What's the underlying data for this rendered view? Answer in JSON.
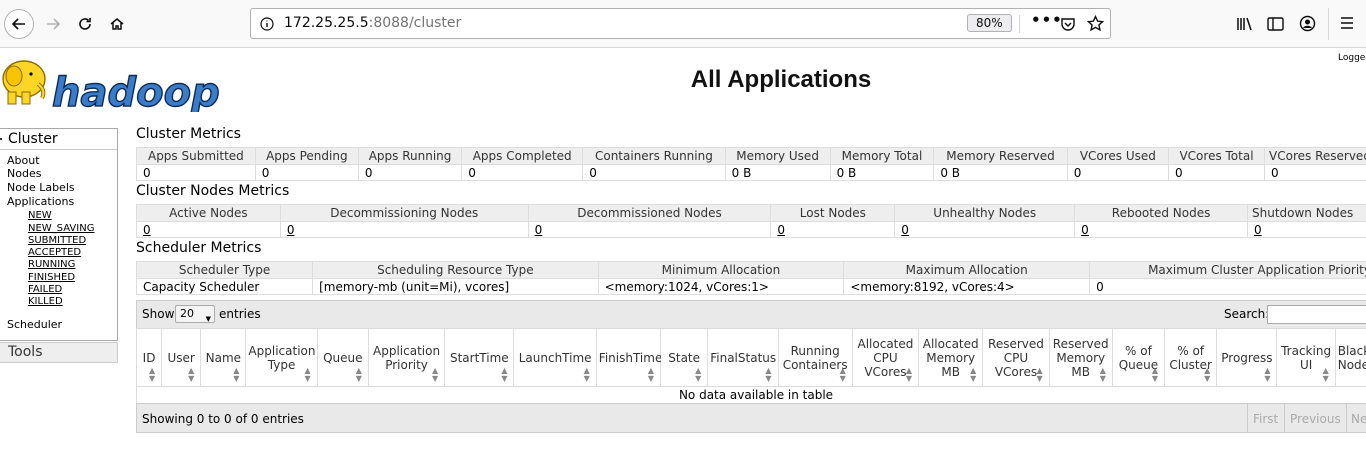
{
  "browser": {
    "url_host": "172.25.25.5",
    "url_rest": ":8088/cluster",
    "zoom": "80%"
  },
  "header": {
    "title": "All Applications",
    "logged_in": "Logged in as: dr.who",
    "logo_text": "hadoop"
  },
  "sidebar": {
    "cluster_label": "Cluster",
    "links": [
      "About",
      "Nodes",
      "Node Labels",
      "Applications"
    ],
    "app_states": [
      "NEW",
      "NEW_SAVING",
      "SUBMITTED",
      "ACCEPTED",
      "RUNNING",
      "FINISHED",
      "FAILED",
      "KILLED"
    ],
    "scheduler": "Scheduler",
    "tools_label": "Tools"
  },
  "cluster_metrics": {
    "title": "Cluster Metrics",
    "headers": [
      "Apps Submitted",
      "Apps Pending",
      "Apps Running",
      "Apps Completed",
      "Containers Running",
      "Memory Used",
      "Memory Total",
      "Memory Reserved",
      "VCores Used",
      "VCores Total",
      "VCores Reserved"
    ],
    "values": [
      "0",
      "0",
      "0",
      "0",
      "0",
      "0 B",
      "0 B",
      "0 B",
      "0",
      "0",
      "0"
    ]
  },
  "node_metrics": {
    "title": "Cluster Nodes Metrics",
    "headers": [
      "Active Nodes",
      "Decommissioning Nodes",
      "Decommissioned Nodes",
      "Lost Nodes",
      "Unhealthy Nodes",
      "Rebooted Nodes",
      "Shutdown Nodes"
    ],
    "values": [
      "0",
      "0",
      "0",
      "0",
      "0",
      "0",
      "0"
    ]
  },
  "scheduler_metrics": {
    "title": "Scheduler Metrics",
    "headers": [
      "Scheduler Type",
      "Scheduling Resource Type",
      "Minimum Allocation",
      "Maximum Allocation",
      "Maximum Cluster Application Priority"
    ],
    "values": [
      "Capacity Scheduler",
      "[memory-mb (unit=Mi), vcores]",
      "<memory:1024, vCores:1>",
      "<memory:8192, vCores:4>",
      "0"
    ]
  },
  "apps": {
    "show_label": "Show",
    "page_size": "20",
    "entries_label": "entries",
    "search_label": "Search:",
    "columns": [
      "ID",
      "User",
      "Name",
      "Application Type",
      "Queue",
      "Application Priority",
      "StartTime",
      "LaunchTime",
      "FinishTime",
      "State",
      "FinalStatus",
      "Running Containers",
      "Allocated CPU VCores",
      "Allocated Memory MB",
      "Reserved CPU VCores",
      "Reserved Memory MB",
      "% of Queue",
      "% of Cluster",
      "Progress",
      "Tracking UI",
      "Blacklisted Nodes"
    ],
    "empty_message": "No data available in table",
    "info": "Showing 0 to 0 of 0 entries",
    "pager": [
      "First",
      "Previous",
      "Next"
    ]
  }
}
